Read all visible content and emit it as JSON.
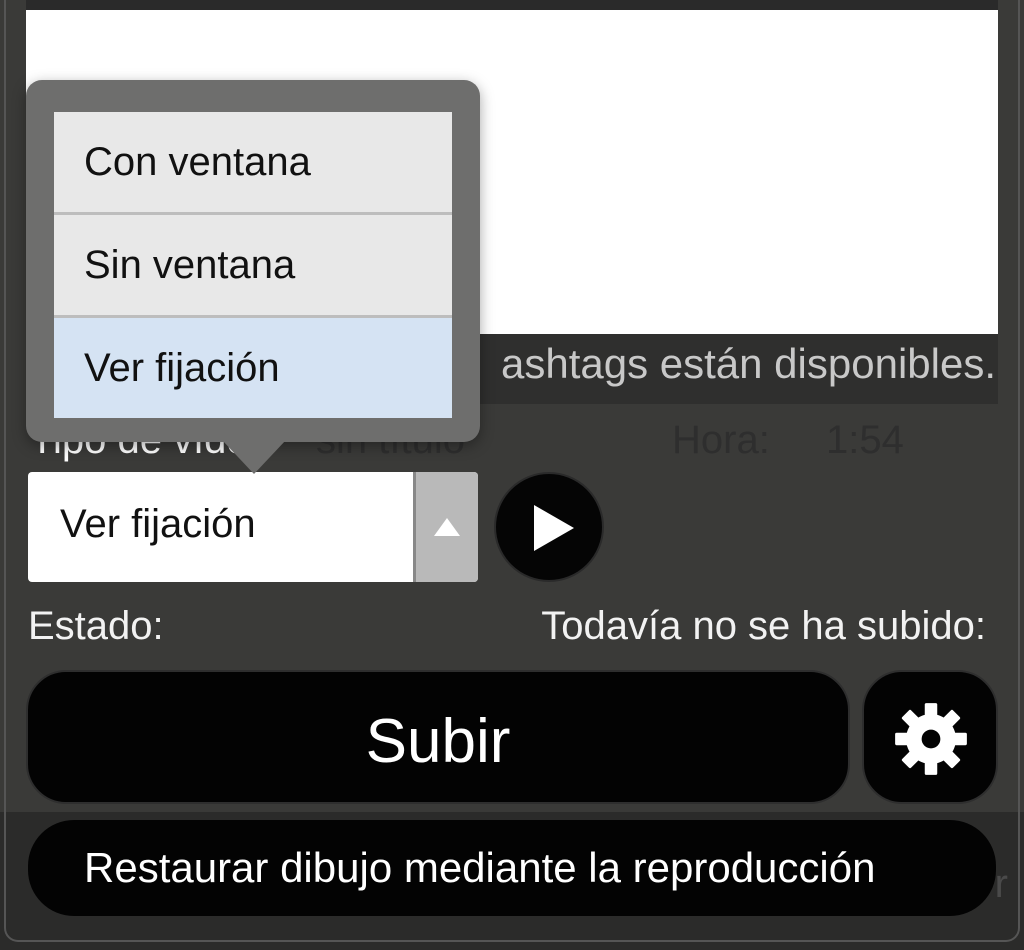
{
  "description_note": "",
  "video_type": {
    "label": "Tipo de vídeo",
    "selected_value": "Ver fijación",
    "options": [
      {
        "label": "Con ventana",
        "selected": false
      },
      {
        "label": "Sin ventana",
        "selected": false
      },
      {
        "label": "Ver fijación",
        "selected": true
      }
    ]
  },
  "hashtag_note": "ashtags están disponibles.",
  "title_placeholder": "sin título",
  "time": {
    "label": "Hora:",
    "value": "1:54"
  },
  "status": {
    "label": "Estado:",
    "value": "Todavía no se ha subido:"
  },
  "upload_label": "Subir",
  "restore_label": "Restaurar dibujo mediante la reproducción",
  "ghost_char": "r",
  "icons": {
    "play": "play-icon",
    "settings": "gear-icon",
    "select_arrow": "triangle-up-icon"
  },
  "colors": {
    "panel_background": "#3a3a38",
    "button_background": "#030303",
    "selected_option": "#d5e3f3",
    "option_background": "#e8e8e8"
  }
}
